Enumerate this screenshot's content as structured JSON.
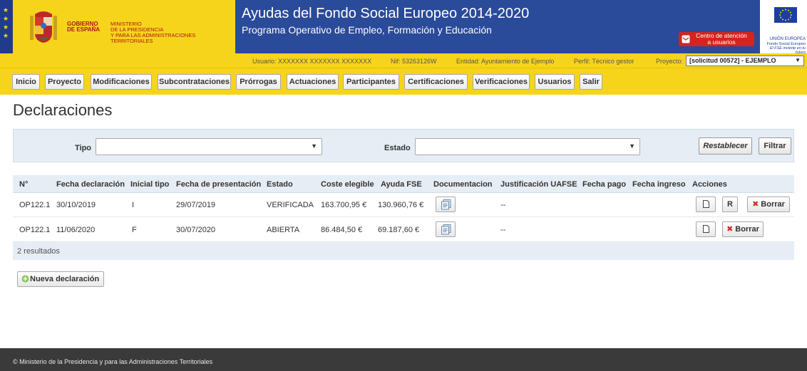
{
  "header": {
    "gov_line1": "GOBIERNO",
    "gov_line2": "DE ESPAÑA",
    "ministry_line1": "MINISTERIO",
    "ministry_line2": "DE LA PRESIDENCIA",
    "ministry_line3": "Y PARA LAS ADMINISTRACIONES TERRITORIALES",
    "title": "Ayudas del Fondo Social Europeo 2014-2020",
    "subtitle": "Programa Operativo de Empleo, Formación y Educación",
    "support_line1": "Centro de atención",
    "support_line2": "a usuarios",
    "eu_line1": "UNIÓN EUROPEA",
    "eu_line2": "Fondo Social Europeo",
    "eu_line3": "El FSE invierte en tu futuro",
    "colors": {
      "blue": "#2a4a9a",
      "yellow": "#f6d41c",
      "red": "#d6231e"
    },
    "icons": [
      "coat-of-arms-icon",
      "mail-icon",
      "eu-flag-icon"
    ]
  },
  "infobar": {
    "user": "Usuario: XXXXXXX XXXXXXX XXXXXXX",
    "nif": "Nif: 53263126W",
    "entity": "Entidad: Ayuntamiento de Ejemplo",
    "profile": "Perfil: Técnico gestor",
    "project_label": "Proyecto:",
    "project_value": "[solicitud 00572] - EJEMPLO"
  },
  "nav": {
    "items": [
      "Inicio",
      "Proyecto",
      "Modificaciones",
      "Subcontrataciones",
      "Prórrogas",
      "Actuaciones",
      "Participantes",
      "Certificaciones",
      "Verificaciones",
      "Usuarios",
      "Salir"
    ]
  },
  "page": {
    "title": "Declaraciones"
  },
  "filter": {
    "tipo_label": "Tipo",
    "tipo_value": "",
    "estado_label": "Estado",
    "estado_value": "",
    "reset_label": "Restablecer",
    "filter_label": "Filtrar"
  },
  "table": {
    "columns": [
      "N°",
      "Fecha declaración",
      "Inicial tipo",
      "Fecha de presentación",
      "Estado",
      "Coste elegible",
      "Ayuda FSE",
      "Documentacion",
      "Justificación UAFSE",
      "Fecha pago",
      "Fecha ingreso",
      "Acciones"
    ],
    "rows": [
      {
        "num": "OP122.1",
        "fecha_declaracion": "30/10/2019",
        "inicial_tipo": "I",
        "fecha_presentacion": "29/07/2019",
        "estado": "VERIFICADA",
        "coste": "163.700,95 €",
        "ayuda": "130.960,76 €",
        "justificacion": "--",
        "fecha_pago": "",
        "fecha_ingreso": "",
        "r_label": "R",
        "delete_label": "Borrar"
      },
      {
        "num": "OP122.1",
        "fecha_declaracion": "11/06/2020",
        "inicial_tipo": "F",
        "fecha_presentacion": "30/07/2020",
        "estado": "ABIERTA",
        "coste": "86.484,50 €",
        "ayuda": "69.187,60 €",
        "justificacion": "--",
        "fecha_pago": "",
        "fecha_ingreso": "",
        "delete_label": "Borrar"
      }
    ],
    "results": "2 resultados"
  },
  "actions": {
    "new_label": "Nueva declaración"
  },
  "footer": {
    "text": "© Ministerio de la Presidencia y para las Administraciones Territoriales"
  }
}
